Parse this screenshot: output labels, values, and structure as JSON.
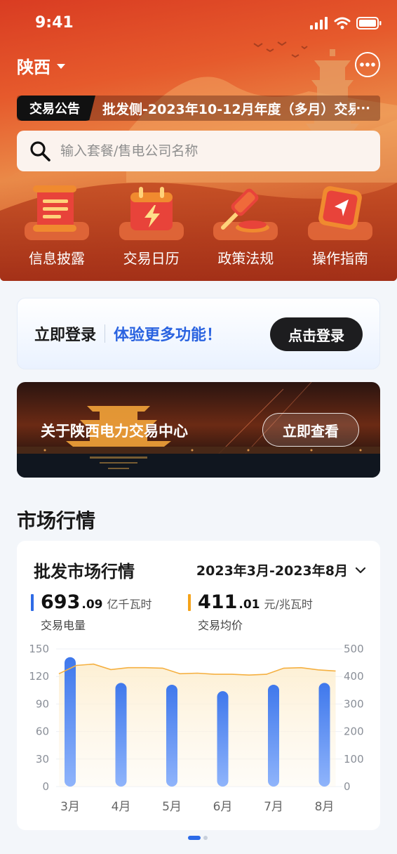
{
  "status_bar": {
    "time": "9:41"
  },
  "header": {
    "region": "陕西",
    "notice_tag": "交易公告",
    "notice_text": "批发侧-2023年10-12月年度（多月）交易",
    "notice_more": "···"
  },
  "search": {
    "placeholder": "输入套餐/售电公司名称"
  },
  "quick_nav": [
    {
      "label": "信息披露",
      "icon": "scroll-icon"
    },
    {
      "label": "交易日历",
      "icon": "calendar-lightning-icon"
    },
    {
      "label": "政策法规",
      "icon": "gavel-icon"
    },
    {
      "label": "操作指南",
      "icon": "compass-icon"
    }
  ],
  "login": {
    "title": "立即登录",
    "subtitle": "体验更多功能！",
    "button": "点击登录"
  },
  "about": {
    "title": "关于陕西电力交易中心",
    "button": "立即查看"
  },
  "market": {
    "section_title": "市场行情",
    "card_title": "批发市场行情",
    "period": "2023年3月-2023年8月",
    "stats": [
      {
        "int": "693",
        "dec": ".09",
        "unit": "亿千瓦时",
        "label": "交易电量",
        "color": "#2f6be6"
      },
      {
        "int": "411",
        "dec": ".01",
        "unit": "元/兆瓦时",
        "label": "交易均价",
        "color": "#f5a31a"
      }
    ]
  },
  "chart_data": {
    "type": "bar",
    "categories": [
      "3月",
      "4月",
      "5月",
      "6月",
      "7月",
      "8月"
    ],
    "series": [
      {
        "name": "交易电量",
        "kind": "bar",
        "axis": "left",
        "values": [
          141,
          113,
          111,
          104,
          111,
          113
        ],
        "color": "#4f86f0"
      },
      {
        "name": "交易均价",
        "kind": "line",
        "axis": "right",
        "values": [
          430,
          425,
          410,
          405,
          428,
          418
        ],
        "color": "#f5b041"
      }
    ],
    "line_detail": [
      410,
      440,
      445,
      425,
      432,
      432,
      430,
      410,
      412,
      408,
      408,
      405,
      408,
      430,
      432,
      424,
      420
    ],
    "left_axis": {
      "ticks": [
        150,
        120,
        90,
        60,
        30,
        0
      ],
      "ylim": [
        0,
        150
      ]
    },
    "right_axis": {
      "ticks": [
        500,
        400,
        300,
        200,
        100,
        0
      ],
      "ylim": [
        0,
        500
      ]
    },
    "grid": true
  }
}
